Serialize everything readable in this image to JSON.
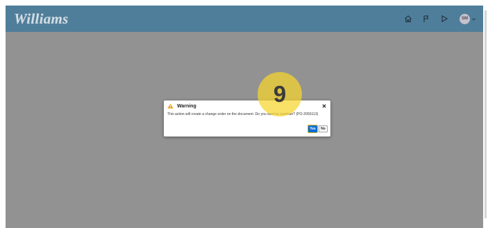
{
  "header": {
    "logo_text": "Williams",
    "icons": [
      "home-icon",
      "flag-icon",
      "play-icon"
    ],
    "avatar_initials": "SM"
  },
  "dialog": {
    "title": "Warning",
    "message": "This action will create a change order on the document. Do you want to continue? (PO-2055113)",
    "yes_label": "Yes",
    "no_label": "No"
  },
  "step_marker": {
    "number": "9"
  },
  "colors": {
    "header_bg": "#4f7e9a",
    "overlay_bg": "#929292",
    "primary_button": "#0a6ed1",
    "warning": "#e8a317",
    "highlight": "#f6d42b"
  }
}
